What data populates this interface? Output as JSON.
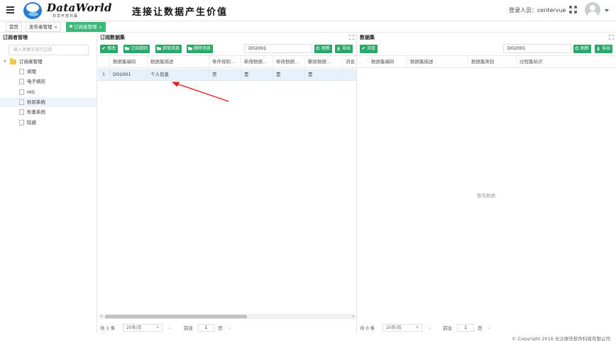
{
  "header": {
    "logo_text": "DataWorld",
    "logo_sub": "共享开放共赢",
    "slogan": "连接让数据产生价值",
    "login_label": "登录人员：centervue"
  },
  "tabs": [
    {
      "label": "首页"
    },
    {
      "label": "发布者管理",
      "close": "×"
    },
    {
      "label": "订阅者管理",
      "close": "×"
    }
  ],
  "left": {
    "title": "订阅者管理",
    "search_placeholder": "输入关键字进行过滤",
    "root": "订阅者管理",
    "items": [
      "病理",
      "电子病历",
      "HIS",
      "检验系统",
      "检查系统",
      "院感"
    ]
  },
  "middle": {
    "title": "订阅数据集",
    "buttons": [
      "修改",
      "订阅规则",
      "获取消息",
      "删除消息"
    ],
    "search_value": "D02001",
    "refresh": "刷新",
    "export": "导出",
    "columns": [
      "数据集编码",
      "数据集描述",
      "条件规则...",
      "新增数据...",
      "修改数据...",
      "删除数据...",
      "消息"
    ],
    "rows": [
      {
        "index": "1",
        "cells": [
          "D02001",
          "个人信息",
          "否",
          "是",
          "是",
          "是",
          ""
        ]
      }
    ],
    "pager": {
      "total": "共 1 条",
      "page_size": "20条/页",
      "goto": "前往",
      "page": "1",
      "page_unit": "页"
    }
  },
  "right": {
    "title": "数据集",
    "button": "浏览",
    "search_value": "D02001",
    "refresh": "刷新",
    "export": "导出",
    "columns": [
      "数据集编码",
      "数据集描述",
      "数据集类别",
      "过程集标识"
    ],
    "empty": "暂无数据",
    "pager": {
      "total": "共 0 条",
      "page_size": "20条/页",
      "goto": "前往",
      "page": "1",
      "page_unit": "页"
    }
  },
  "footer": "© Copyright 2016 长沙廖氏软件科技有限公司",
  "colors": {
    "accent": "#3cb878",
    "button": "#2aa86a",
    "annotation": "#e02020"
  }
}
